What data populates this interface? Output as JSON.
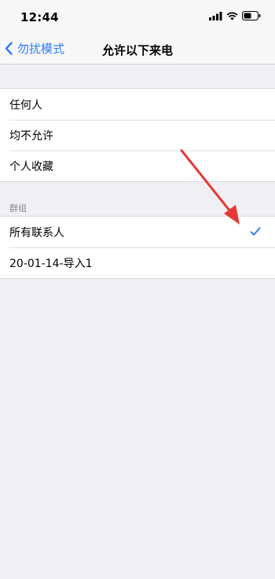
{
  "status_bar": {
    "time": "12:44",
    "icons": [
      "signal-icon",
      "wifi-icon",
      "battery-icon"
    ]
  },
  "nav": {
    "back_label": "勿扰模式",
    "title": "允许以下来电"
  },
  "options": [
    {
      "label": "任何人"
    },
    {
      "label": "均不允许"
    },
    {
      "label": "个人收藏"
    }
  ],
  "groups_section": {
    "header": "群组",
    "items": [
      {
        "label": "所有联系人",
        "selected": true
      },
      {
        "label": "20-01-14-导入1",
        "selected": false
      }
    ]
  },
  "colors": {
    "accent": "#2f7cf6",
    "annotation_arrow": "#e53935"
  }
}
